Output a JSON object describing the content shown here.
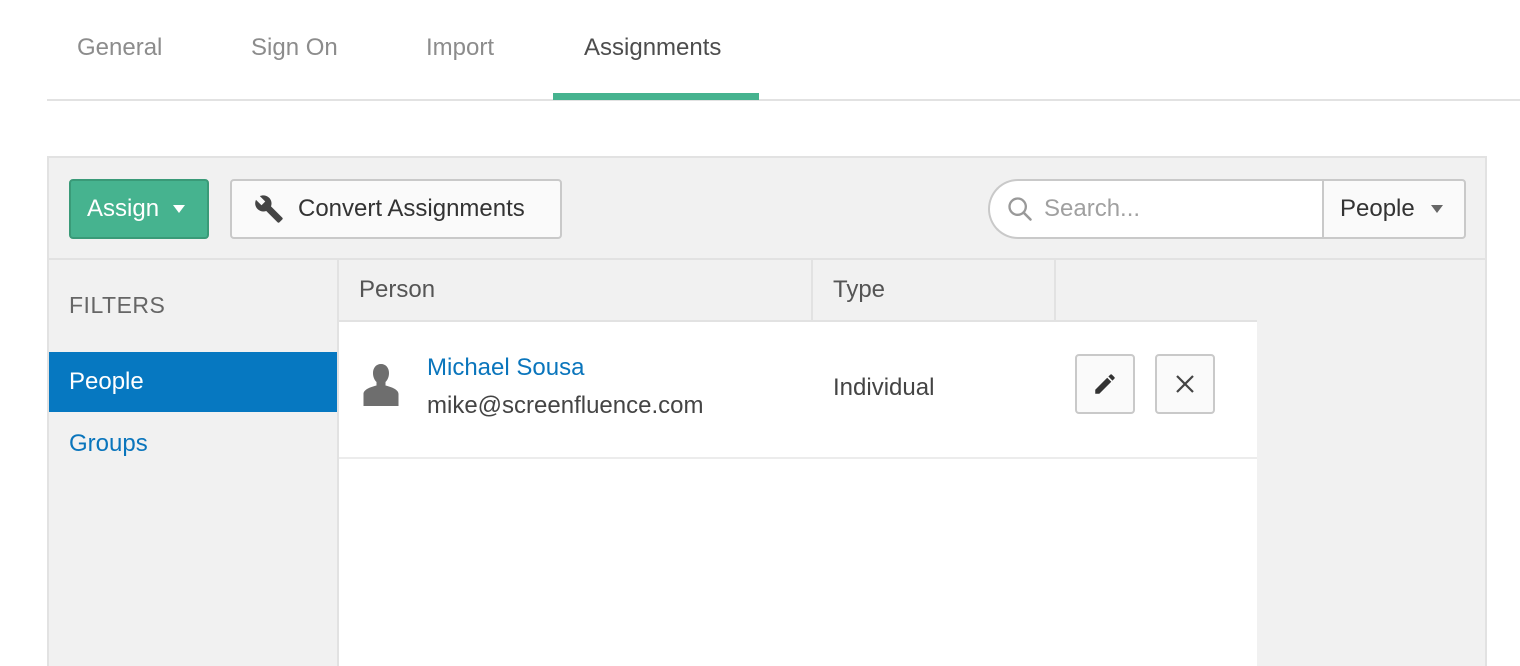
{
  "tabs": [
    {
      "label": "General"
    },
    {
      "label": "Sign On"
    },
    {
      "label": "Import"
    },
    {
      "label": "Assignments"
    }
  ],
  "active_tab": "Assignments",
  "toolbar": {
    "assign_label": "Assign",
    "convert_label": "Convert Assignments",
    "search_placeholder": "Search...",
    "search_scope": "People"
  },
  "filters": {
    "title": "FILTERS",
    "items": [
      {
        "label": "People",
        "active": true
      },
      {
        "label": "Groups",
        "active": false
      }
    ]
  },
  "table": {
    "columns": [
      "Person",
      "Type"
    ],
    "rows": [
      {
        "name": "Michael Sousa",
        "email": "mike@screenfluence.com",
        "type": "Individual"
      }
    ]
  },
  "colors": {
    "accent_green": "#46b38f",
    "link_blue": "#0a75bc",
    "active_filter_bg": "#0678c1"
  },
  "icons": [
    "wrench-icon",
    "search-icon",
    "person-icon",
    "pencil-icon",
    "close-icon",
    "caret-down-icon"
  ]
}
